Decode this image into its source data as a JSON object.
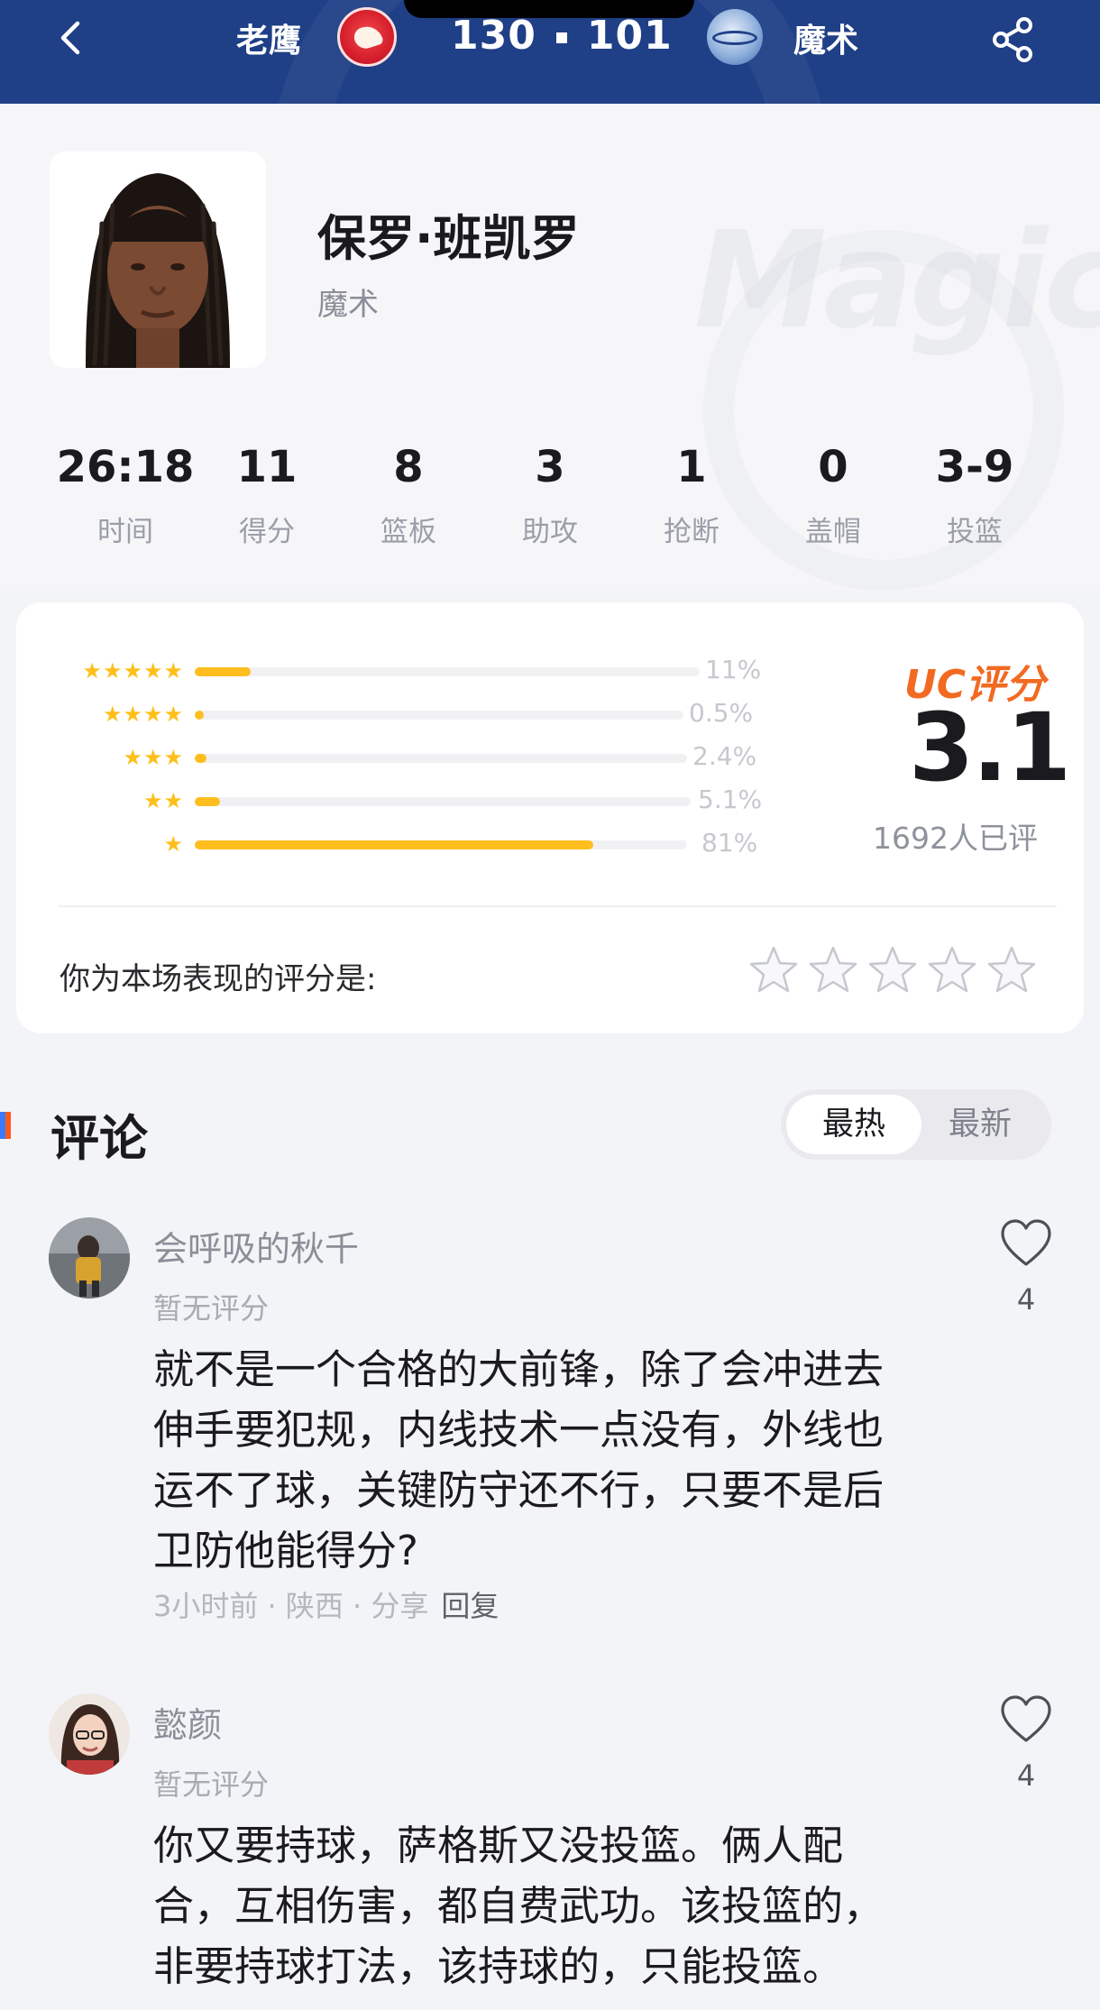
{
  "header": {
    "home_team": "老鹰",
    "home_score": "130",
    "away_score": "101",
    "away_team": "魔术"
  },
  "player": {
    "name": "保罗·班凯罗",
    "team": "魔术",
    "watermark": "Magic"
  },
  "stats": [
    {
      "value": "26:18",
      "label": "时间"
    },
    {
      "value": "11",
      "label": "得分"
    },
    {
      "value": "8",
      "label": "篮板"
    },
    {
      "value": "3",
      "label": "助攻"
    },
    {
      "value": "1",
      "label": "抢断"
    },
    {
      "value": "0",
      "label": "盖帽"
    },
    {
      "value": "3-9",
      "label": "投篮"
    }
  ],
  "rating": {
    "distribution": [
      {
        "stars": "★★★★★",
        "percent_label": "11%",
        "fraction": 0.11
      },
      {
        "stars": "★★★★",
        "percent_label": "0.5%",
        "fraction": 0.005
      },
      {
        "stars": "★★★",
        "percent_label": "2.4%",
        "fraction": 0.024
      },
      {
        "stars": "★★",
        "percent_label": "5.1%",
        "fraction": 0.051
      },
      {
        "stars": "★",
        "percent_label": "81%",
        "fraction": 0.81
      }
    ],
    "uc_label": "UC评分",
    "score": "3.1",
    "count_label": "1692人已评",
    "prompt": "你为本场表现的评分是:",
    "accent_color": "#f26a22",
    "bar_color": "#ffbe1e"
  },
  "comments_section": {
    "title": "评论",
    "tabs": [
      "最热",
      "最新"
    ],
    "active_tab": "最热",
    "items": [
      {
        "user": "会呼吸的秋千",
        "rating": "暂无评分",
        "lines": [
          "就不是一个合格的大前锋，除了会冲进去",
          "伸手要犯规，内线技术一点没有，外线也",
          "运不了球，关键防守还不行，只要不是后",
          "卫防他能得分?"
        ],
        "meta": "3小时前 · 陕西 · 分享",
        "reply": "回复",
        "likes": "4"
      },
      {
        "user": "懿颜",
        "rating": "暂无评分",
        "lines": [
          "你又要持球，萨格斯又没投篮。俩人配",
          "合，互相伤害，都自费武功。该投篮的，",
          "非要持球打法，该持球的，只能投篮。"
        ],
        "likes": "4"
      }
    ]
  }
}
